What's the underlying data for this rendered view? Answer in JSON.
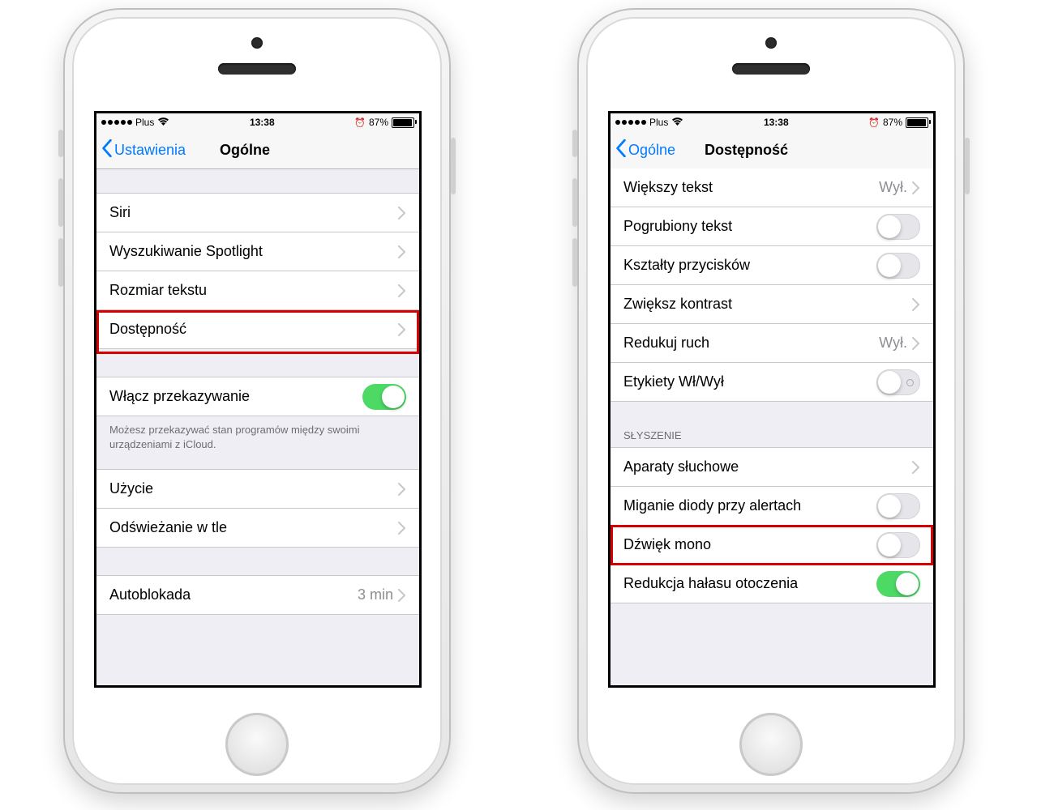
{
  "status": {
    "carrier": "Plus",
    "time": "13:38",
    "battery_pct": "87%",
    "battery_fill": 0.87
  },
  "left": {
    "back_label": "Ustawienia",
    "title": "Ogólne",
    "group1": [
      {
        "label": "Siri"
      },
      {
        "label": "Wyszukiwanie Spotlight"
      },
      {
        "label": "Rozmiar tekstu"
      },
      {
        "label": "Dostępność",
        "highlight": true
      }
    ],
    "handoff": {
      "label": "Włącz przekazywanie",
      "on": true,
      "note": "Możesz przekazywać stan programów między swoimi urządzeniami z iCloud."
    },
    "group3": [
      {
        "label": "Użycie"
      },
      {
        "label": "Odświeżanie w tle"
      }
    ],
    "autolock": {
      "label": "Autoblokada",
      "value": "3 min"
    }
  },
  "right": {
    "back_label": "Ogólne",
    "title": "Dostępność",
    "vision": [
      {
        "label": "Większy tekst",
        "value": "Wył.",
        "type": "link"
      },
      {
        "label": "Pogrubiony tekst",
        "type": "toggle",
        "on": false
      },
      {
        "label": "Kształty przycisków",
        "type": "toggle",
        "on": false
      },
      {
        "label": "Zwiększ kontrast",
        "type": "link"
      },
      {
        "label": "Redukuj ruch",
        "value": "Wył.",
        "type": "link"
      },
      {
        "label": "Etykiety Wł/Wył",
        "type": "toggle",
        "on": false,
        "labeled": true
      }
    ],
    "hearing_header": "SŁYSZENIE",
    "hearing": [
      {
        "label": "Aparaty słuchowe",
        "type": "link"
      },
      {
        "label": "Miganie diody przy alertach",
        "type": "toggle",
        "on": false
      },
      {
        "label": "Dźwięk mono",
        "type": "toggle",
        "on": false,
        "highlight": true
      },
      {
        "label": "Redukcja hałasu otoczenia",
        "type": "toggle",
        "on": true
      }
    ]
  }
}
